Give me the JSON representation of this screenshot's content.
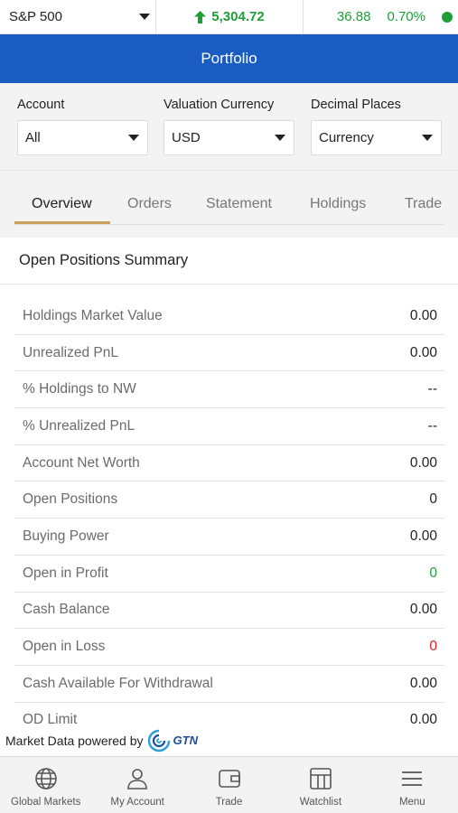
{
  "ticker": {
    "symbol": "S&P 500",
    "price": "5,304.72",
    "change": "36.88",
    "change_pct": "0.70%",
    "up_color": "#1e9e38",
    "up-icon": "arrow-up-icon"
  },
  "header": {
    "title": "Portfolio",
    "bg_color": "#1a5cc2"
  },
  "filters": {
    "account": {
      "label": "Account",
      "value": "All"
    },
    "currency": {
      "label": "Valuation Currency",
      "value": "USD"
    },
    "decimals": {
      "label": "Decimal Places",
      "value": "Currency"
    }
  },
  "tabs": [
    {
      "label": "Overview",
      "active": true
    },
    {
      "label": "Orders"
    },
    {
      "label": "Statement"
    },
    {
      "label": "Holdings"
    },
    {
      "label": "Trade"
    }
  ],
  "summary": {
    "title": "Open Positions Summary",
    "rows": [
      {
        "label": "Holdings Market Value",
        "value": "0.00"
      },
      {
        "label": "Unrealized PnL",
        "value": "0.00"
      },
      {
        "label": "% Holdings to NW",
        "value": "--"
      },
      {
        "label": "% Unrealized PnL",
        "value": "--"
      },
      {
        "label": "Account Net Worth",
        "value": "0.00"
      },
      {
        "label": "Open Positions",
        "value": "0"
      },
      {
        "label": "Buying Power",
        "value": "0.00"
      },
      {
        "label": "Open in Profit",
        "value": "0"
      },
      {
        "label": "Cash Balance",
        "value": "0.00"
      },
      {
        "label": "Open in Loss",
        "value": "0"
      },
      {
        "label": "Cash Available For Withdrawal",
        "value": "0.00"
      },
      {
        "label": "OD Limit",
        "value": "0.00"
      }
    ]
  },
  "powered_by": {
    "text": "Market Data powered by",
    "brand": "GTN"
  },
  "bottom_nav": [
    {
      "label": "Global Markets",
      "icon": "globe-icon"
    },
    {
      "label": "My Account",
      "icon": "user-icon"
    },
    {
      "label": "Trade",
      "icon": "wallet-icon"
    },
    {
      "label": "Watchlist",
      "icon": "watchlist-icon"
    },
    {
      "label": "Menu",
      "icon": "menu-icon"
    }
  ]
}
